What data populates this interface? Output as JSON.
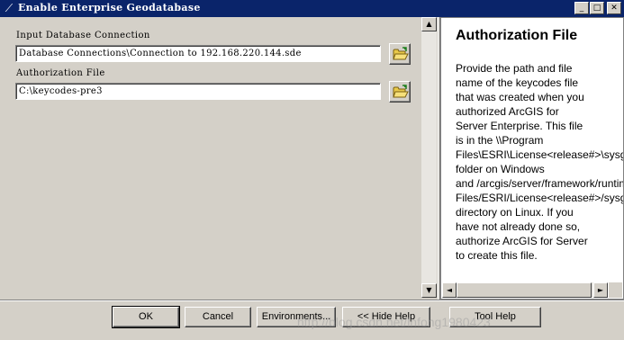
{
  "window": {
    "title": "Enable Enterprise Geodatabase",
    "controls": [
      "minimize-icon",
      "maximize-icon",
      "close-icon"
    ],
    "minimize_glyph": "_",
    "maximize_glyph": "□",
    "close_glyph": "✕"
  },
  "form": {
    "input_db": {
      "label": "Input Database Connection",
      "value": "Database Connections\\Connection to 192.168.220.144.sde"
    },
    "auth_file": {
      "label": "Authorization File",
      "value": "C:\\keycodes-pre3"
    }
  },
  "help": {
    "title": "Authorization File",
    "lines": [
      "Provide the path and file",
      "name of the keycodes file",
      "that was created when you",
      "authorized ArcGIS for",
      "Server Enterprise. This file",
      "is in the \\\\Program",
      "Files\\ESRI\\License<release#>\\sysgen",
      "folder on Windows",
      "and /arcgis/server/framework/runtime/.wine/drive_c/Program",
      "Files/ESRI/License<release#>/sysgen",
      "directory on Linux. If you",
      "have not already done so,",
      "authorize ArcGIS for Server",
      "to create this file."
    ]
  },
  "buttons": {
    "ok": "OK",
    "cancel": "Cancel",
    "environments": "Environments...",
    "hide_help": "<< Hide Help",
    "tool_help": "Tool Help"
  },
  "watermark": "http://blog.csdn.net/lnfong1980423",
  "icons": {
    "browse": "open-folder-icon",
    "scroll_up": "▲",
    "scroll_down": "▼",
    "scroll_left": "◄",
    "scroll_right": "►"
  },
  "colors": {
    "titlebar": "#0a246a",
    "face": "#d4d0c8",
    "folder": "#e8c94a"
  }
}
